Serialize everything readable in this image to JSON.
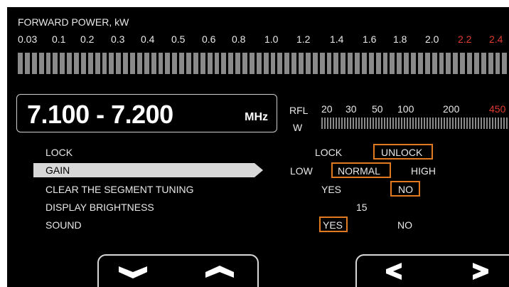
{
  "forward_power": {
    "title": "FORWARD  POWER, kW",
    "scale": [
      {
        "label": "0.03",
        "color": "#e8e8e8"
      },
      {
        "label": "0.1",
        "color": "#e8e8e8"
      },
      {
        "label": "0.2",
        "color": "#e8e8e8"
      },
      {
        "label": "0.3",
        "color": "#e8e8e8"
      },
      {
        "label": "0.4",
        "color": "#e8e8e8"
      },
      {
        "label": "0.5",
        "color": "#e8e8e8"
      },
      {
        "label": "0.6",
        "color": "#e8e8e8"
      },
      {
        "label": "0.8",
        "color": "#e8e8e8"
      },
      {
        "label": "1.0",
        "color": "#e8e8e8"
      },
      {
        "label": "1.2",
        "color": "#e8e8e8"
      },
      {
        "label": "1.4",
        "color": "#e8e8e8"
      },
      {
        "label": "1.6",
        "color": "#e8e8e8"
      },
      {
        "label": "1.8",
        "color": "#e8e8e8"
      },
      {
        "label": "2.0",
        "color": "#e8e8e8"
      },
      {
        "label": "2.2",
        "color": "#e03a2e"
      },
      {
        "label": "2.4",
        "color": "#e03a2e"
      }
    ]
  },
  "frequency": {
    "range": "7.100 - 7.200",
    "unit": "MHz"
  },
  "reflected_power": {
    "label": "RFL",
    "unit": "W",
    "scale": [
      {
        "label": "20",
        "color": "#e8e8e8"
      },
      {
        "label": "30",
        "color": "#e8e8e8"
      },
      {
        "label": "50",
        "color": "#e8e8e8"
      },
      {
        "label": "100",
        "color": "#e8e8e8"
      },
      {
        "label": "200",
        "color": "#e8e8e8"
      },
      {
        "label": "450",
        "color": "#e03a2e"
      }
    ]
  },
  "menu": {
    "items": [
      "LOCK",
      "GAIN",
      "CLEAR  THE  SEGMENT  TUNING",
      "DISPLAY  BRIGHTNESS",
      "SOUND"
    ],
    "selected": "GAIN"
  },
  "options": {
    "lock": [
      "LOCK",
      "UNLOCK"
    ],
    "lock_selected": "UNLOCK",
    "gain": [
      "LOW",
      "NORMAL",
      "HIGH"
    ],
    "gain_selected": "NORMAL",
    "clear": [
      "YES",
      "NO"
    ],
    "clear_selected": "NO",
    "brightness": "15",
    "sound": [
      "YES",
      "NO"
    ],
    "sound_selected": "YES"
  },
  "colors": {
    "accent": "#e07a20",
    "warning": "#e03a2e",
    "background": "#000000",
    "meter": "#8a8a8a"
  },
  "icons": {
    "down": "chevron-down-icon",
    "up": "chevron-up-icon",
    "left": "chevron-left-icon",
    "right": "chevron-right-icon"
  }
}
